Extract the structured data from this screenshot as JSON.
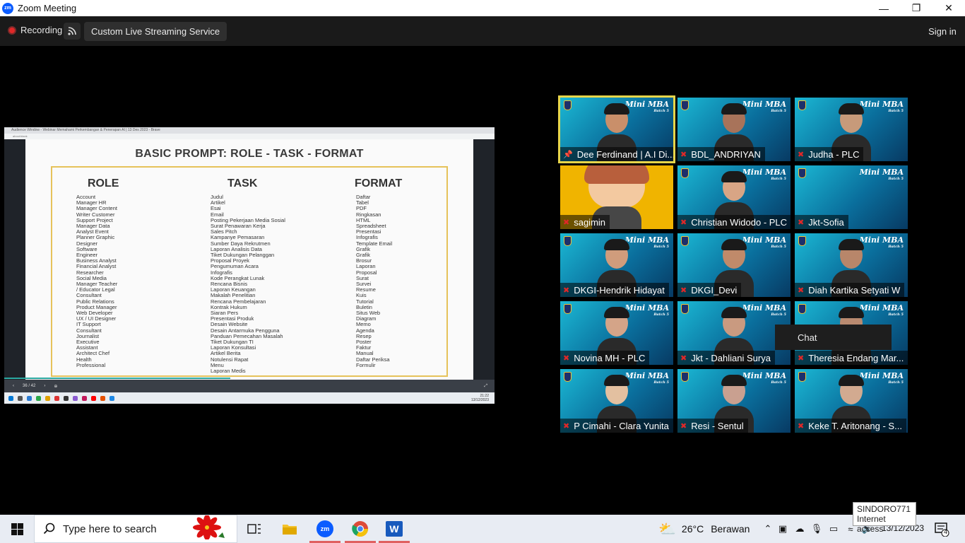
{
  "window": {
    "title": "Zoom Meeting",
    "minimize": "—",
    "maximize": "❐",
    "close": "✕"
  },
  "toolbar": {
    "recording_label": "Recording",
    "streaming_label": "Custom Live Streaming Service",
    "signin_label": "Sign in"
  },
  "share": {
    "browser_tab": "Audience Window - Webinar Memahami Perkembangan & Penerapan AI | 13 Des 2023 - Brave",
    "address": "about:blank",
    "slide_title": "BASIC PROMPT: ROLE -  TASK - FORMAT",
    "columns": [
      {
        "heading": "ROLE",
        "items": [
          "Account",
          "Manager HR",
          "Manager Content",
          "Writer Customer",
          "Support Project",
          "Manager Data",
          "Analyst Event",
          "Planner Graphic",
          "Designer",
          "Software",
          "Engineer",
          "Business Analyst",
          "Financial Analyst",
          "Researcher",
          "Social Media",
          "Manager Teacher",
          "/ Educator Legal",
          "Consultant",
          "Public Relations",
          "Product Manager",
          "Web Developer",
          "UX / UI Designer",
          "IT Support",
          "Consultant",
          "Journalist",
          "Executive",
          "Assistant",
          "Architect Chef",
          "Health",
          "Professional"
        ]
      },
      {
        "heading": "TASK",
        "items": [
          "Judul",
          "Artikel",
          "Esai",
          "Email",
          "Posting Pekerjaan Media Sosial",
          "Surat Penawaran Kerja",
          "Sales Pitch",
          "Kampanye Pemasaran",
          "Sumber Daya Rekrutmen",
          "Laporan Analisis Data",
          "Tiket Dukungan Pelanggan",
          "Proposal Proyek",
          "Pengumuman Acara",
          "Infografis",
          "Kode Perangkat Lunak",
          "Rencana Bisnis",
          "Laporan Keuangan",
          "Makalah Penelitian",
          "Rencana Pembelajaran",
          "Kontrak Hukum",
          "Siaran Pers",
          "Presentasi Produk",
          "Desain Website",
          "Desain Antarmuka Pengguna",
          "Panduan Pemecahan Masalah",
          "Tiket Dukungan TI",
          "Laporan Konsultasi",
          "Artikel Berita",
          "Notulensi Rapat",
          "Menu",
          "Laporan Medis"
        ]
      },
      {
        "heading": "FORMAT",
        "items": [
          "Daftar",
          "Tabel",
          "PDF",
          "Ringkasan",
          "HTML",
          "Spreadsheet",
          "Presentasi",
          "Infografis",
          "Template Email",
          "Grafik",
          "Grafik",
          "Brosur",
          "Laporan",
          "Proposal",
          "Surat",
          "Survei",
          "Resume",
          "Kuis",
          "Tutorial",
          "Buletin",
          "Situs Web",
          "Diagram",
          "Memo",
          "Agenda",
          "Resep",
          "Poster",
          "Faktur",
          "Manual",
          "Daftar Periksa",
          "Formulir"
        ]
      }
    ],
    "page_indicator": "36 / 42",
    "mini_clock": "21:22",
    "mini_date": "13/12/2023"
  },
  "gallery": {
    "brand": "Mini MBA",
    "batch": "Batch 5",
    "participants": [
      {
        "name": "Dee Ferdinand | A.I Di...",
        "pinned": true,
        "active": true
      },
      {
        "name": "BDL_ANDRIYAN"
      },
      {
        "name": "Judha - PLC"
      },
      {
        "name": "sagimin",
        "avatar": "cartoon"
      },
      {
        "name": "Christian Widodo - PLC"
      },
      {
        "name": "Jkt-Sofia"
      },
      {
        "name": "DKGI-Hendrik Hidayat"
      },
      {
        "name": "DKGI_Devi"
      },
      {
        "name": "Diah Kartika Setyati W"
      },
      {
        "name": "Novina MH - PLC"
      },
      {
        "name": "Jkt - Dahliani Surya"
      },
      {
        "name": "Theresia Endang Mar..."
      },
      {
        "name": "P Cimahi - Clara Yunita"
      },
      {
        "name": "Resi - Sentul"
      },
      {
        "name": "Keke T. Aritonang - S..."
      }
    ]
  },
  "chat_popup": "Chat",
  "taskbar": {
    "search_placeholder": "Type here to search",
    "weather_temp": "26°C",
    "weather_desc": "Berawan",
    "date": "13/12/2023",
    "notif_count": "4"
  },
  "tooltip": {
    "network": "SINDORO771",
    "status": "Internet access"
  },
  "colors": {
    "zoom_blue": "#0b5cff",
    "record_red": "#e02828",
    "active_speaker": "#e6d54a",
    "slide_frame": "#e6c25a"
  }
}
